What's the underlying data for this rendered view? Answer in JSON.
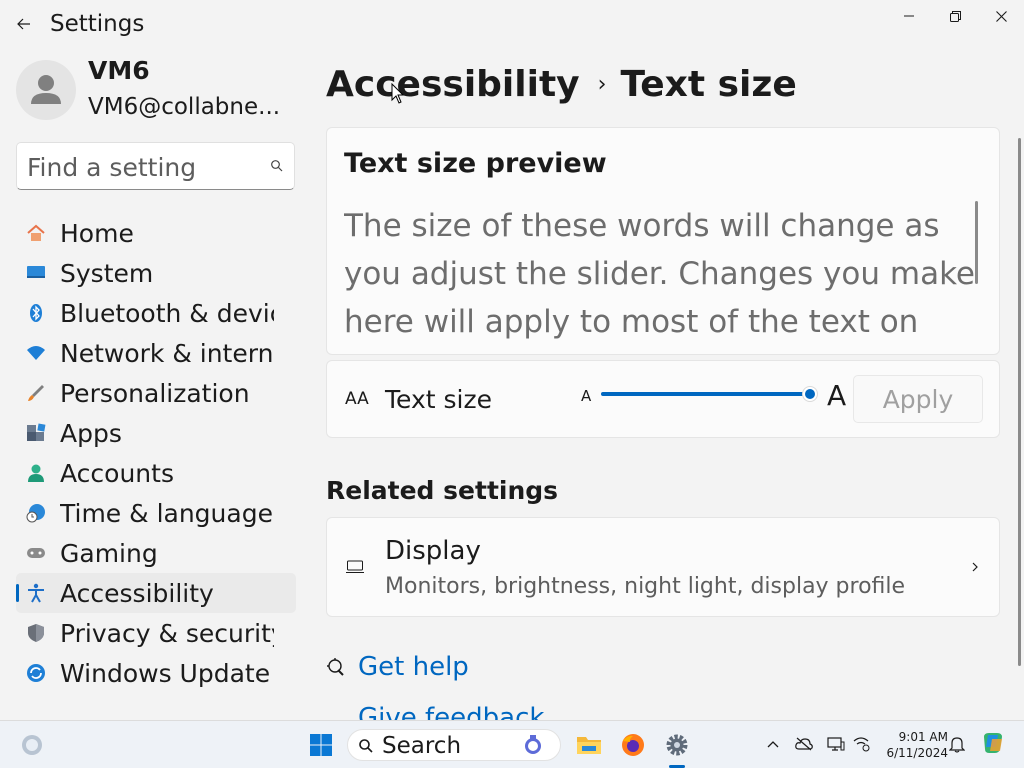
{
  "window": {
    "title": "Settings",
    "back_label": "Back",
    "controls": {
      "minimize": "Minimize",
      "restore": "Restore",
      "close": "Close"
    }
  },
  "profile": {
    "name": "VM6",
    "email": "VM6@collabne..."
  },
  "search": {
    "placeholder": "Find a setting"
  },
  "nav": {
    "items": [
      {
        "label": "Home",
        "icon": "home-icon"
      },
      {
        "label": "System",
        "icon": "system-icon"
      },
      {
        "label": "Bluetooth & devices",
        "icon": "bluetooth-icon"
      },
      {
        "label": "Network & internet",
        "icon": "network-icon"
      },
      {
        "label": "Personalization",
        "icon": "brush-icon"
      },
      {
        "label": "Apps",
        "icon": "apps-icon"
      },
      {
        "label": "Accounts",
        "icon": "accounts-icon"
      },
      {
        "label": "Time & language",
        "icon": "globe-clock-icon"
      },
      {
        "label": "Gaming",
        "icon": "gamepad-icon"
      },
      {
        "label": "Accessibility",
        "icon": "accessibility-icon",
        "selected": true
      },
      {
        "label": "Privacy & security",
        "icon": "shield-icon"
      },
      {
        "label": "Windows Update",
        "icon": "update-icon"
      }
    ]
  },
  "breadcrumb": {
    "parent": "Accessibility",
    "separator": "›",
    "current": "Text size"
  },
  "preview": {
    "title": "Text size preview",
    "text": "The size of these words will change as you adjust the slider. Changes you make here will apply to most of the text on"
  },
  "text_size": {
    "label": "Text size",
    "icon_text": "AA",
    "small_a": "A",
    "big_a": "A",
    "slider_value_fraction": 1.0,
    "apply_label": "Apply"
  },
  "related": {
    "title": "Related settings",
    "display": {
      "title": "Display",
      "subtitle": "Monitors, brightness, night light, display profile"
    }
  },
  "links": {
    "help": "Get help",
    "feedback": "Give feedback"
  },
  "taskbar": {
    "search_label": "Search",
    "time": "9:01 AM",
    "date": "6/11/2024"
  },
  "colors": {
    "accent": "#0067c0",
    "background": "#f3f3f3",
    "card": "#fbfbfb"
  }
}
